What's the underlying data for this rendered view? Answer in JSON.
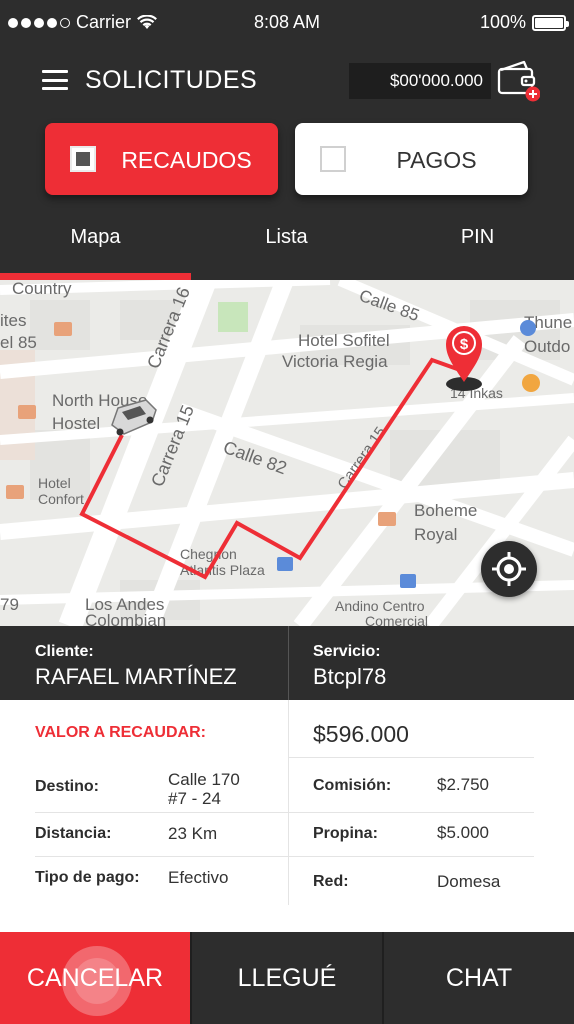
{
  "status_bar": {
    "carrier": "Carrier",
    "time": "8:08 AM",
    "battery": "100%",
    "signal_bars": 4
  },
  "header": {
    "title": "SOLICITUDES",
    "balance": "$00'000.000"
  },
  "toggle": {
    "recaudos": "RECAUDOS",
    "pagos": "PAGOS",
    "selected": "recaudos"
  },
  "tabs": [
    {
      "label": "Mapa",
      "active": true
    },
    {
      "label": "Lista",
      "active": false
    },
    {
      "label": "PIN",
      "active": false
    }
  ],
  "map": {
    "labels": [
      "Country",
      "ites",
      "el 85",
      "North House",
      "Hostel",
      "Carrera 16",
      "Hotel Sofitel",
      "Victoria Regia",
      "Thune",
      "Outdo",
      "14 Inkas",
      "Carrera 15",
      "Calle 82",
      "Calle 85",
      "Hotel",
      "Confort",
      "Boheme",
      "Royal",
      "Chegnon",
      "Atlantis Plaza",
      "Los Andes",
      "Colombian",
      "Andino Centro",
      "Comercial",
      "79"
    ],
    "pin_symbol": "$"
  },
  "client": {
    "cliente_label": "Cliente:",
    "cliente_value": "RAFAEL MARTÍNEZ",
    "servicio_label": "Servicio:",
    "servicio_value": "Btcpl78"
  },
  "details": {
    "valor_label": "VALOR A RECAUDAR:",
    "valor_value": "$596.000",
    "destino_label": "Destino:",
    "destino_line1": "Calle 170",
    "destino_line2": "#7 - 24",
    "comision_label": "Comisión:",
    "comision_value": "$2.750",
    "distancia_label": "Distancia:",
    "distancia_value": "23 Km",
    "propina_label": "Propina:",
    "propina_value": "$5.000",
    "tipo_label": "Tipo de pago:",
    "tipo_value": "Efectivo",
    "red_label": "Red:",
    "red_value": "Domesa"
  },
  "actions": {
    "cancel": "CANCELAR",
    "arrived": "LLEGUÉ",
    "chat": "CHAT"
  },
  "colors": {
    "accent": "#ee2e36",
    "dark": "#2d2d2d",
    "white": "#ffffff"
  }
}
